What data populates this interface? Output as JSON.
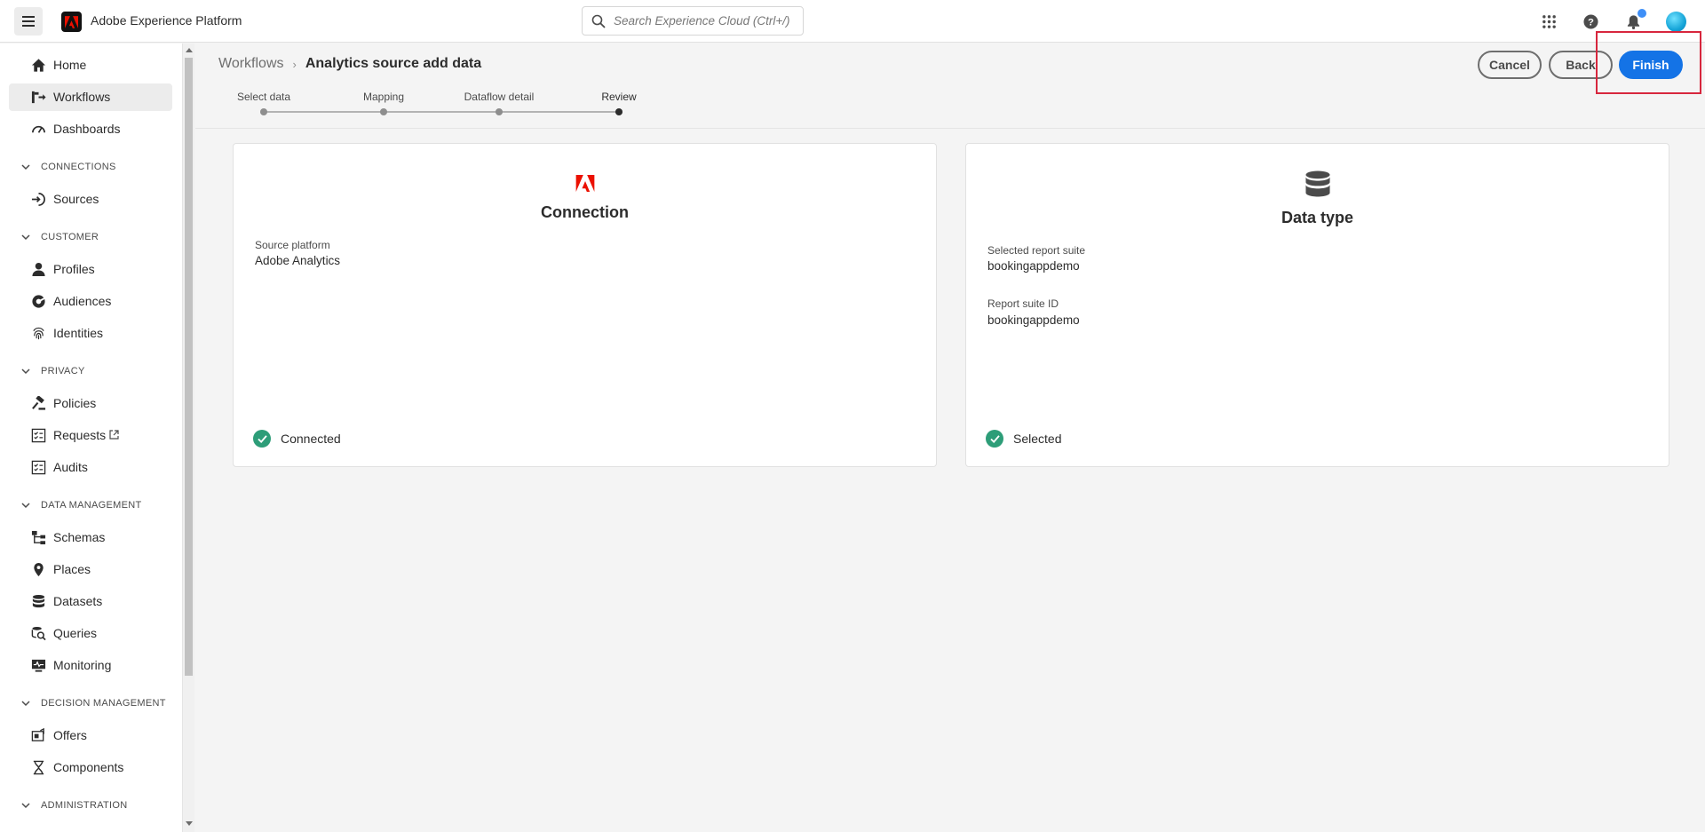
{
  "app": {
    "title": "Adobe Experience Platform"
  },
  "search": {
    "placeholder": "Search Experience Cloud (Ctrl+/)"
  },
  "topbar_icons": [
    "apps-grid-icon",
    "help-icon",
    "bell-icon"
  ],
  "sidebar": {
    "items": [
      {
        "label": "Home",
        "icon": "home-icon"
      },
      {
        "label": "Workflows",
        "icon": "workflows-icon",
        "active": true
      },
      {
        "label": "Dashboards",
        "icon": "dashboard-icon"
      },
      {
        "label": "Sources",
        "icon": "sources-icon"
      },
      {
        "label": "Profiles",
        "icon": "profile-icon"
      },
      {
        "label": "Audiences",
        "icon": "audiences-icon"
      },
      {
        "label": "Identities",
        "icon": "fingerprint-icon"
      },
      {
        "label": "Policies",
        "icon": "gavel-icon"
      },
      {
        "label": "Requests",
        "icon": "checklist-icon"
      },
      {
        "label": "Audits",
        "icon": "checklist-icon"
      },
      {
        "label": "Schemas",
        "icon": "schema-icon"
      },
      {
        "label": "Places",
        "icon": "pin-icon"
      },
      {
        "label": "Datasets",
        "icon": "database-icon"
      },
      {
        "label": "Queries",
        "icon": "query-icon"
      },
      {
        "label": "Monitoring",
        "icon": "monitor-icon"
      },
      {
        "label": "Offers",
        "icon": "offers-icon"
      },
      {
        "label": "Components",
        "icon": "hourglass-icon"
      }
    ],
    "sections": [
      "CONNECTIONS",
      "CUSTOMER",
      "PRIVACY",
      "DATA MANAGEMENT",
      "DECISION MANAGEMENT",
      "ADMINISTRATION"
    ]
  },
  "breadcrumb": {
    "parent": "Workflows",
    "current": "Analytics source add data"
  },
  "buttons": {
    "cancel": "Cancel",
    "back": "Back",
    "finish": "Finish"
  },
  "stepper": {
    "steps": [
      "Select data",
      "Mapping",
      "Dataflow detail",
      "Review"
    ],
    "current_index": 3
  },
  "connection_card": {
    "title": "Connection",
    "icon": "adobe-logo-icon",
    "field_label": "Source platform",
    "field_value": "Adobe Analytics",
    "status": "Connected"
  },
  "datatype_card": {
    "title": "Data type",
    "icon": "database-icon",
    "fields": [
      {
        "label": "Selected report suite",
        "value": "bookingappdemo"
      },
      {
        "label": "Report suite ID",
        "value": "bookingappdemo"
      }
    ],
    "status": "Selected"
  },
  "colors": {
    "primary": "#1473e6",
    "success": "#2d9d78",
    "brand_red": "#eb1000",
    "highlight": "#d7263d"
  }
}
